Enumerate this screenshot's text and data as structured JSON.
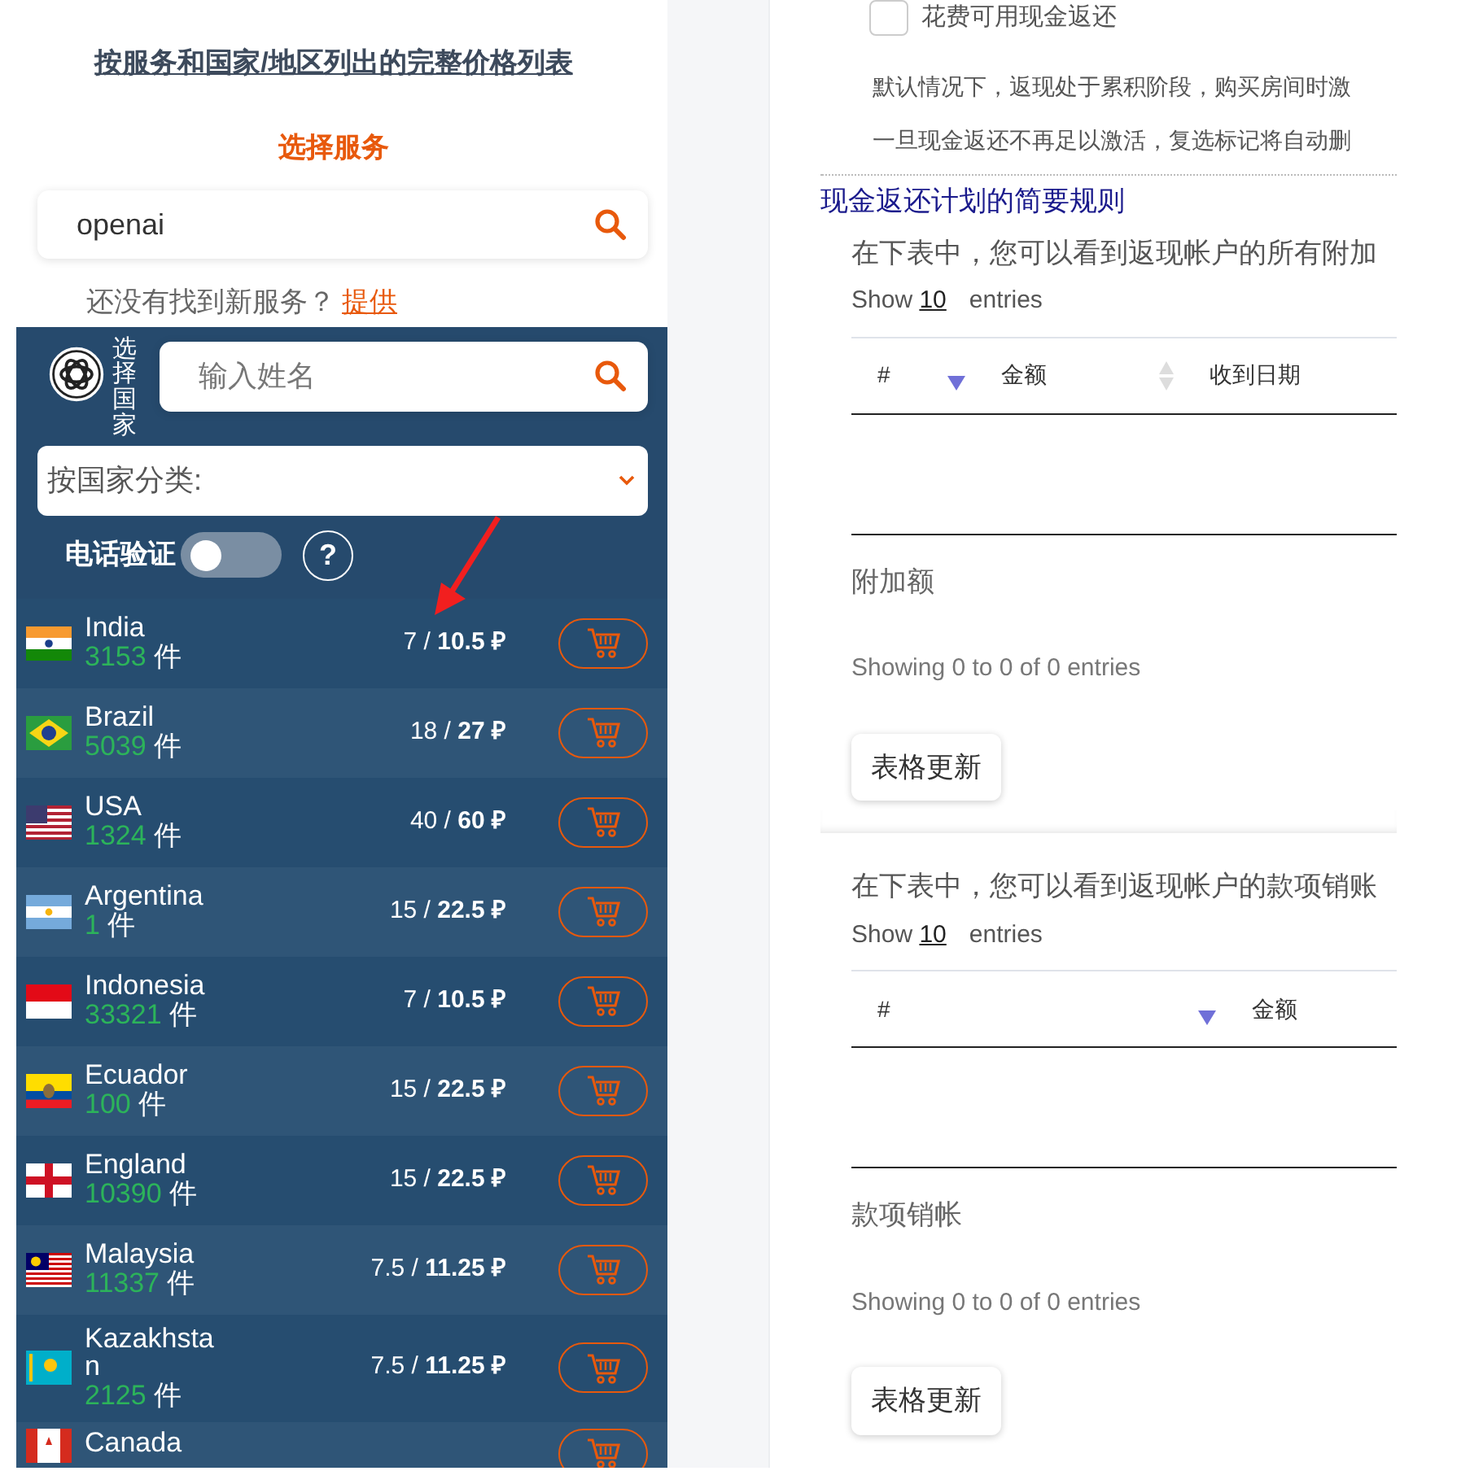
{
  "price_list_link": "按服务和国家/地区列出的完整价格列表",
  "service_heading": "选择服务",
  "service_search": {
    "value": "openai"
  },
  "not_found": {
    "text": "还没有找到新服务？",
    "link": "提供"
  },
  "country_panel": {
    "label": "选择国家",
    "name_search": {
      "placeholder": "输入姓名"
    },
    "sort_select": {
      "value": "按国家分类:"
    },
    "phone_verification": {
      "label": "电话验证",
      "on": false
    },
    "help": "?"
  },
  "countries": [
    {
      "name": "India",
      "count": "3153",
      "unit": "件",
      "price": "7 / **10.5 ₽**"
    },
    {
      "name": "Brazil",
      "count": "5039",
      "unit": "件",
      "price": "18 / **27 ₽**"
    },
    {
      "name": "USA",
      "count": "1324",
      "unit": "件",
      "price": "40 / **60 ₽**"
    },
    {
      "name": "Argentina",
      "count": "1",
      "unit": "件",
      "price": "15 / **22.5 ₽**"
    },
    {
      "name": "Indonesia",
      "count": "33321",
      "unit": "件",
      "price": "7 / **10.5 ₽**"
    },
    {
      "name": "Ecuador",
      "count": "100",
      "unit": "件",
      "price": "15 / **22.5 ₽**"
    },
    {
      "name": "England",
      "count": "10390",
      "unit": "件",
      "price": "15 / **22.5 ₽**"
    },
    {
      "name": "Malaysia",
      "count": "11337",
      "unit": "件",
      "price": "7.5 / **11.25 ₽**"
    },
    {
      "name": "Kazakhstan",
      "count": "2125",
      "unit": "件",
      "price": "7.5 / **11.25 ₽**"
    },
    {
      "name": "Canada"
    }
  ],
  "cashback": {
    "checkbox": {
      "label": "花费可用现金返还",
      "checked": false
    },
    "paragraphs": [
      "默认情况下，返现处于累积阶段，购买房间时激",
      "一旦现金返还不再足以激活，复选标记将自动删"
    ],
    "rules_link": "现金返还计划的简要规则"
  },
  "tables": [
    {
      "description": "在下表中，您可以看到返现帐户的所有附加",
      "length": {
        "prefix": "Show",
        "value": "10",
        "suffix": "entries"
      },
      "columns": [
        {
          "label": "#",
          "sorted": true
        },
        {
          "label": "金额",
          "sorted": false
        },
        {
          "label": "收到日期"
        }
      ],
      "caption": "附加额",
      "info": "Showing 0 to 0 of 0 entries",
      "button": "表格更新"
    },
    {
      "description": "在下表中，您可以看到返现帐户的款项销账",
      "length": {
        "prefix": "Show",
        "value": "10",
        "suffix": "entries"
      },
      "columns": [
        {
          "label": "#",
          "sorted": true
        },
        {
          "label": "金额"
        }
      ],
      "caption": "款项销帐",
      "info": "Showing 0 to 0 of 0 entries",
      "button": "表格更新"
    }
  ]
}
